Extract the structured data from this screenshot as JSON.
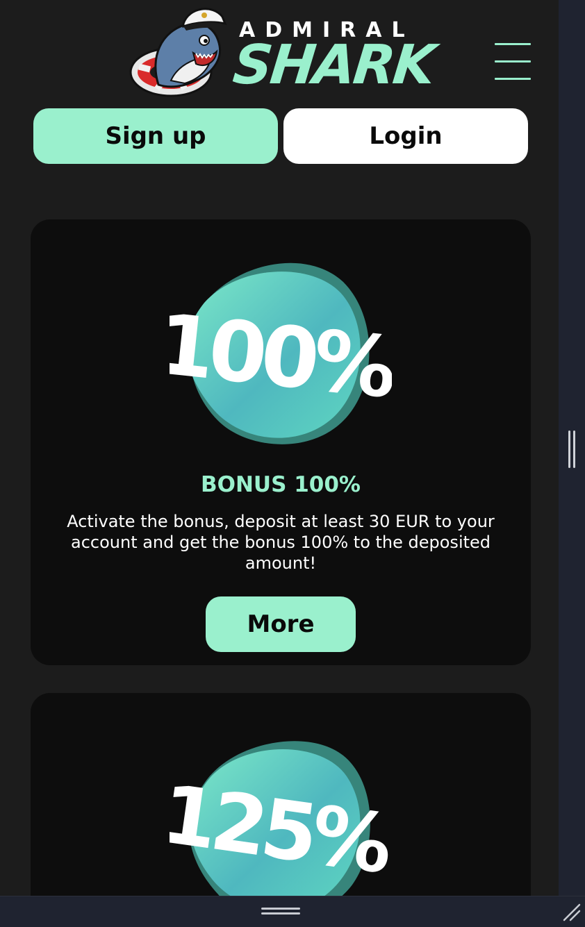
{
  "brand": {
    "line1": "ADMIRAL",
    "line2": "SHARK"
  },
  "header": {
    "signup_label": "Sign up",
    "login_label": "Login",
    "menu_icon": "hamburger-menu-icon"
  },
  "bonuses": [
    {
      "badge": "100%",
      "title": "BONUS 100%",
      "description": "Activate the bonus, deposit at least 30 EUR to your account and get the bonus 100% to the deposited amount!",
      "button_label": "More"
    },
    {
      "badge": "125%"
    }
  ],
  "colors": {
    "accent": "#9af0cd",
    "card_bg": "#0d0d0d",
    "page_bg": "#1c1c1c",
    "blob_light": "#6fe3c4",
    "blob_dark": "#3a9fa6"
  }
}
